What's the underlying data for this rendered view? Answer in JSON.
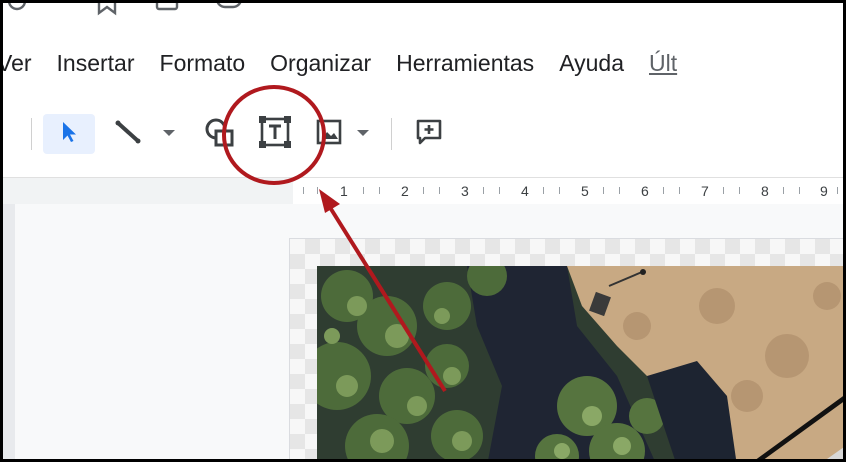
{
  "menu": {
    "items": [
      "Ver",
      "Insertar",
      "Formato",
      "Organizar",
      "Herramientas",
      "Ayuda",
      "Últ"
    ]
  },
  "toolbar": {
    "tools": [
      {
        "name": "select",
        "icon": "cursor-arrow-icon"
      },
      {
        "name": "line",
        "icon": "line-icon"
      },
      {
        "name": "shape",
        "icon": "shape-icon"
      },
      {
        "name": "textbox",
        "icon": "textbox-icon"
      },
      {
        "name": "image",
        "icon": "image-icon"
      },
      {
        "name": "comment",
        "icon": "add-comment-icon"
      }
    ]
  },
  "ruler": {
    "labels": [
      "1",
      "2",
      "3",
      "4",
      "5",
      "6",
      "7",
      "8",
      "9"
    ]
  },
  "annotation": {
    "highlight_color": "#b0191e",
    "target": "textbox-button"
  },
  "colors": {
    "accent": "#1a73e8",
    "active_bg": "#e8f0fe",
    "annotation": "#b0191e"
  }
}
